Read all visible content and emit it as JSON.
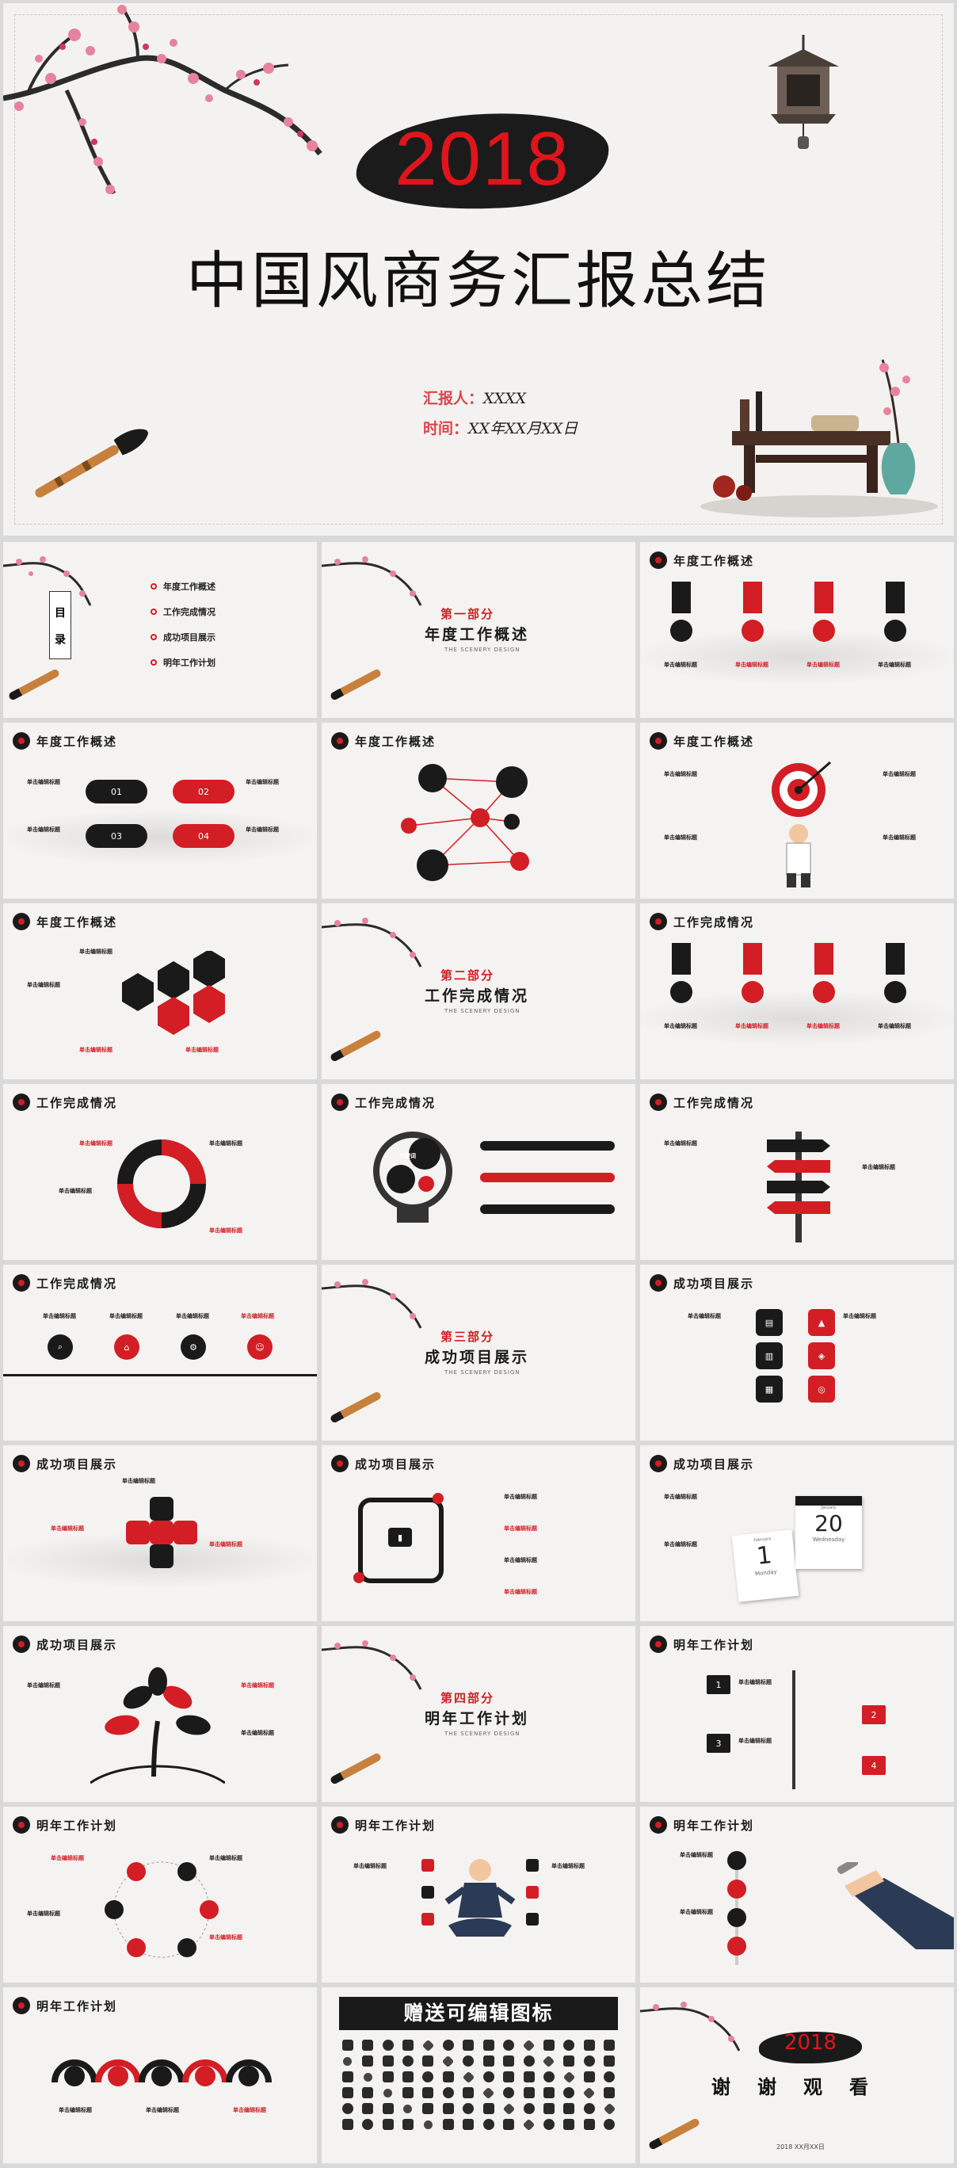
{
  "cover": {
    "year": "2018",
    "title": "中国风商务汇报总结",
    "reporter_label": "汇报人：",
    "reporter_value": "XXXX",
    "time_label": "时间：",
    "time_value": "XX年XX月XX日"
  },
  "toc": {
    "box_char_1": "目",
    "box_char_2": "录",
    "items": [
      "年度工作概述",
      "工作完成情况",
      "成功项目展示",
      "明年工作计划"
    ]
  },
  "sections": [
    {
      "num": "第一部分",
      "title": "年度工作概述",
      "sub": "THE SCENERY DESIGN"
    },
    {
      "num": "第二部分",
      "title": "工作完成情况",
      "sub": "THE SCENERY DESIGN"
    },
    {
      "num": "第三部分",
      "title": "成功项目展示",
      "sub": "THE SCENERY DESIGN"
    },
    {
      "num": "第四部分",
      "title": "明年工作计划",
      "sub": "THE SCENERY DESIGN"
    }
  ],
  "headings": {
    "h1": "年度工作概述",
    "h2": "工作完成情况",
    "h3": "成功项目展示",
    "h4": "明年工作计划"
  },
  "labels": {
    "edit_title": "单击编辑标题",
    "key_word": "关键词",
    "steps": [
      "01",
      "02",
      "03",
      "04"
    ],
    "cal_day_1": "1",
    "cal_day_1_name": "Monday",
    "cal_day_20": "20",
    "cal_day_20_name": "Wednesday",
    "cal_month_1": "February",
    "cal_month_20": "January",
    "plan_nums": [
      "1",
      "2",
      "3",
      "4"
    ]
  },
  "gift": {
    "banner": "赠送可编辑图标"
  },
  "thanks": {
    "year": "2018",
    "text": "谢谢观看",
    "footer": "2018 XX月XX日"
  },
  "colors": {
    "accent_red": "#d21e24",
    "ink_black": "#1a1a1a",
    "paper": "#f4f3f1"
  }
}
